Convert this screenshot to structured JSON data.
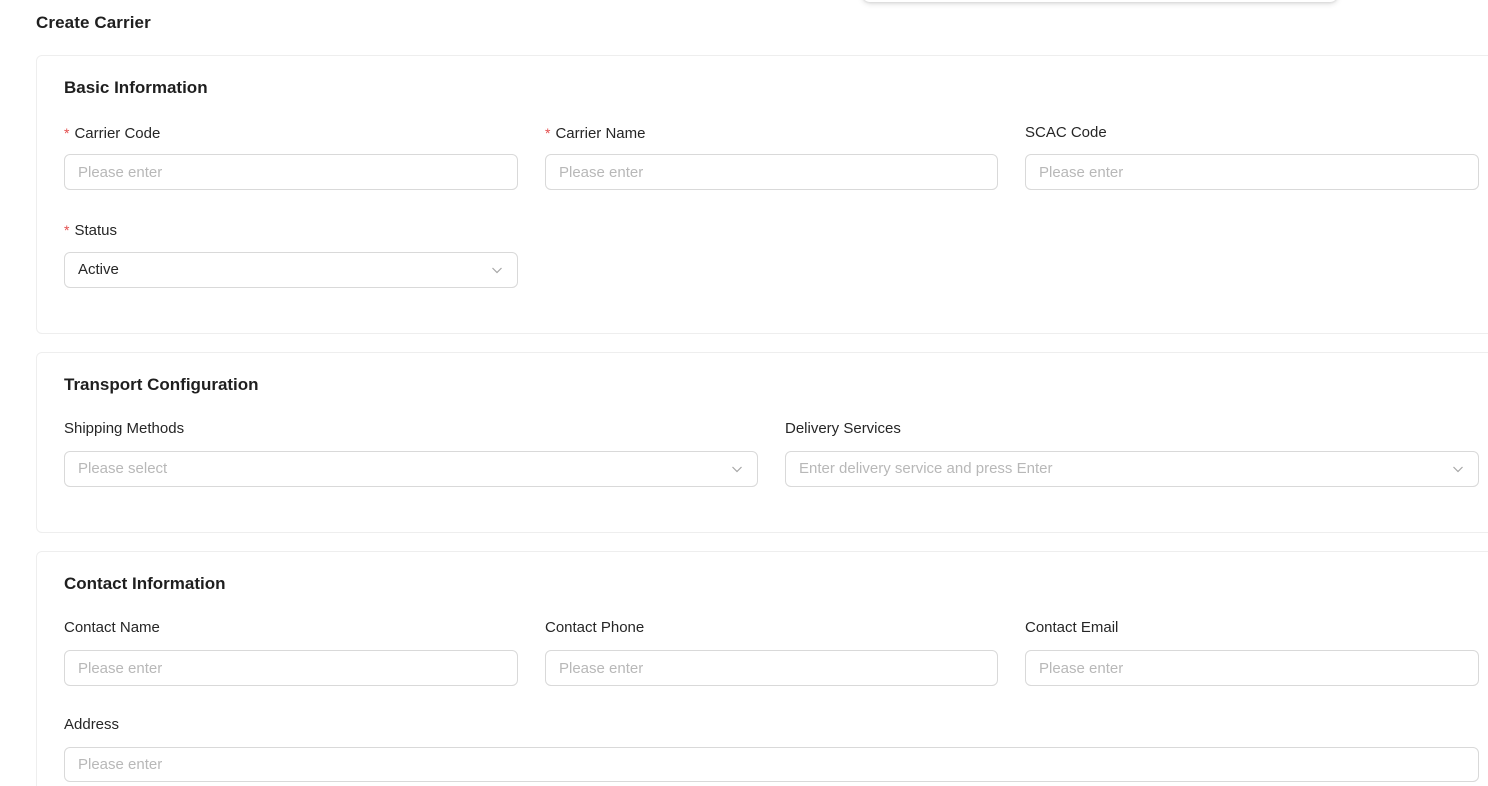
{
  "page": {
    "title": "Create Carrier"
  },
  "basic": {
    "title": "Basic Information",
    "carrier_code": {
      "label": "Carrier Code",
      "required": "*",
      "placeholder": "Please enter",
      "value": ""
    },
    "carrier_name": {
      "label": "Carrier Name",
      "required": "*",
      "placeholder": "Please enter",
      "value": ""
    },
    "scac_code": {
      "label": "SCAC Code",
      "placeholder": "Please enter",
      "value": ""
    },
    "status": {
      "label": "Status",
      "required": "*",
      "value": "Active"
    }
  },
  "transport": {
    "title": "Transport Configuration",
    "shipping_methods": {
      "label": "Shipping Methods",
      "placeholder": "Please select"
    },
    "delivery_services": {
      "label": "Delivery Services",
      "placeholder": "Enter delivery service and press Enter"
    }
  },
  "contact": {
    "title": "Contact Information",
    "contact_name": {
      "label": "Contact Name",
      "placeholder": "Please enter",
      "value": ""
    },
    "contact_phone": {
      "label": "Contact Phone",
      "placeholder": "Please enter",
      "value": ""
    },
    "contact_email": {
      "label": "Contact Email",
      "placeholder": "Please enter",
      "value": ""
    },
    "address": {
      "label": "Address",
      "placeholder": "Please enter",
      "value": ""
    }
  },
  "icons": {
    "dropdown": "chevron-down-icon"
  },
  "colors": {
    "required_marker": "#e34d4d",
    "border": "#d9d9d9",
    "placeholder": "#b8b8b8"
  }
}
